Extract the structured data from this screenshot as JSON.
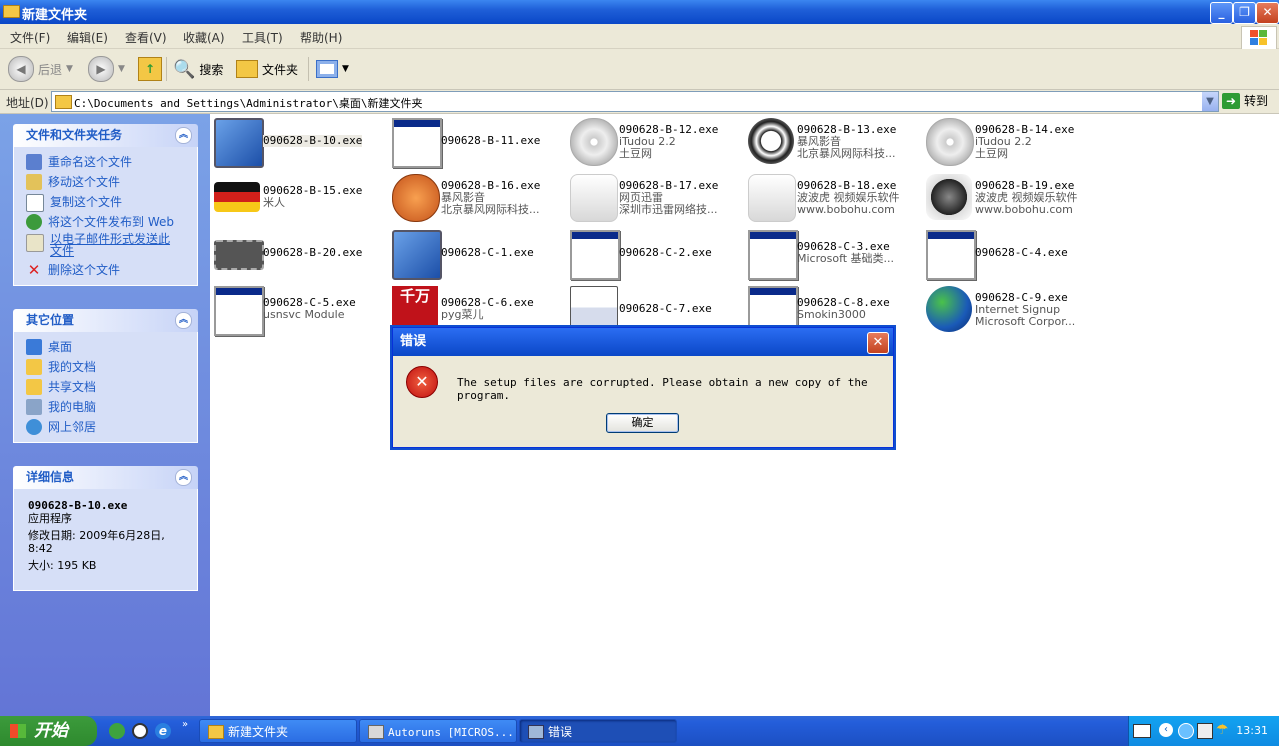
{
  "window": {
    "title": "新建文件夹"
  },
  "menu": [
    "文件(F)",
    "编辑(E)",
    "查看(V)",
    "收藏(A)",
    "工具(T)",
    "帮助(H)"
  ],
  "toolbar": {
    "back": "后退",
    "search": "搜索",
    "folders": "文件夹"
  },
  "address": {
    "label": "地址(D)",
    "path": "C:\\Documents and Settings\\Administrator\\桌面\\新建文件夹",
    "go": "转到"
  },
  "tasks_panel": {
    "title": "文件和文件夹任务",
    "items": [
      "重命名这个文件",
      "移动这个文件",
      "复制这个文件",
      "将这个文件发布到 Web",
      "以电子邮件形式发送此文件",
      "删除这个文件"
    ]
  },
  "places_panel": {
    "title": "其它位置",
    "items": [
      "桌面",
      "我的文档",
      "共享文档",
      "我的电脑",
      "网上邻居"
    ]
  },
  "details_panel": {
    "title": "详细信息",
    "name": "090628-B-10.exe",
    "type": "应用程序",
    "modified": "修改日期: 2009年6月28日, 8:42",
    "size": "大小: 195 KB"
  },
  "files": [
    {
      "name": "090628-B-10.exe",
      "l1": "",
      "l2": "",
      "icon": "installer-icon"
    },
    {
      "name": "090628-B-11.exe",
      "l1": "",
      "l2": "",
      "icon": "window-icon"
    },
    {
      "name": "090628-B-12.exe",
      "l1": "iTudou 2.2",
      "l2": "土豆网",
      "icon": "cd-icon"
    },
    {
      "name": "090628-B-13.exe",
      "l1": "暴风影音",
      "l2": "北京暴风网际科技...",
      "icon": "soccer-ball-icon"
    },
    {
      "name": "090628-B-14.exe",
      "l1": "iTudou 2.2",
      "l2": "土豆网",
      "icon": "cd-icon"
    },
    {
      "name": "090628-B-15.exe",
      "l1": "米人",
      "l2": "",
      "icon": "german-flag-icon"
    },
    {
      "name": "090628-B-16.exe",
      "l1": "暴风影音",
      "l2": "北京暴风网际科技...",
      "icon": "basketball-icon"
    },
    {
      "name": "090628-B-17.exe",
      "l1": "网页迅雷",
      "l2": "深圳市迅雷网络技...",
      "icon": "device-icon"
    },
    {
      "name": "090628-B-18.exe",
      "l1": "波波虎 视频娱乐软件",
      "l2": "www.bobohu.com",
      "icon": "device-icon"
    },
    {
      "name": "090628-B-19.exe",
      "l1": "波波虎 视频娱乐软件",
      "l2": "www.bobohu.com",
      "icon": "globe-device-icon"
    },
    {
      "name": "090628-B-20.exe",
      "l1": "",
      "l2": "",
      "icon": "chip-icon"
    },
    {
      "name": "090628-C-1.exe",
      "l1": "",
      "l2": "",
      "icon": "installer-icon"
    },
    {
      "name": "090628-C-2.exe",
      "l1": "",
      "l2": "",
      "icon": "window-icon"
    },
    {
      "name": "090628-C-3.exe",
      "l1": "Microsoft 基础类...",
      "l2": "",
      "icon": "window-icon"
    },
    {
      "name": "090628-C-4.exe",
      "l1": "",
      "l2": "",
      "icon": "window-icon"
    },
    {
      "name": "090628-C-5.exe",
      "l1": "usnsvc Module",
      "l2": "",
      "icon": "window-icon"
    },
    {
      "name": "090628-C-6.exe",
      "l1": "pyg菜儿",
      "l2": "",
      "icon": "qianwan-icon"
    },
    {
      "name": "090628-C-7.exe",
      "l1": "",
      "l2": "",
      "icon": "setup-icon"
    },
    {
      "name": "090628-C-8.exe",
      "l1": "Smokin3000",
      "l2": "",
      "icon": "window-icon"
    },
    {
      "name": "090628-C-9.exe",
      "l1": "Internet Signup",
      "l2": "Microsoft Corpor...",
      "icon": "globe-computer-icon"
    }
  ],
  "dialog": {
    "title": "错误",
    "message": "The setup files are corrupted. Please obtain a new copy of the program.",
    "ok": "确定"
  },
  "taskbar": {
    "start": "开始",
    "items": [
      "新建文件夹",
      "Autoruns [MICROS...",
      "错误"
    ],
    "clock": "13:31"
  }
}
